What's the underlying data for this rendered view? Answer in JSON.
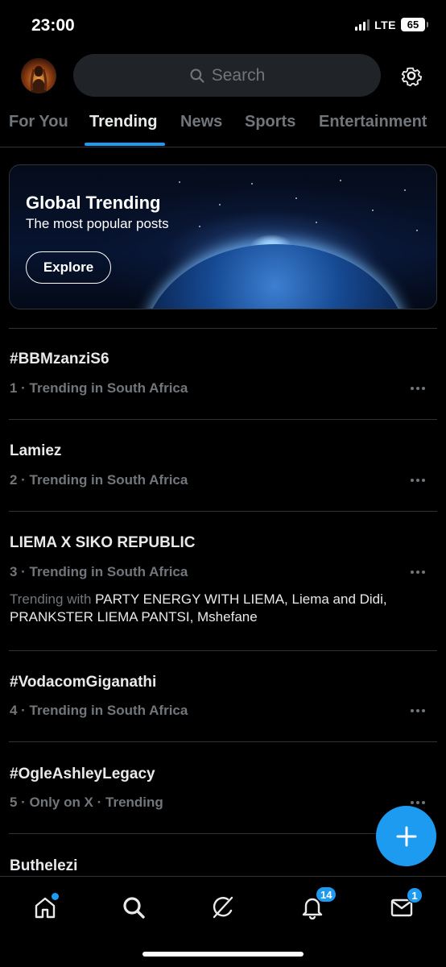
{
  "status_bar": {
    "time": "23:00",
    "network": "LTE",
    "battery": "65"
  },
  "header": {
    "search_placeholder": "Search"
  },
  "tabs": [
    {
      "label": "For You"
    },
    {
      "label": "Trending"
    },
    {
      "label": "News"
    },
    {
      "label": "Sports"
    },
    {
      "label": "Entertainment"
    }
  ],
  "active_tab": "Trending",
  "banner": {
    "title": "Global Trending",
    "subtitle": "The most popular posts",
    "button_label": "Explore"
  },
  "trends": [
    {
      "title": "#BBMzanziS6",
      "meta": "1 · Trending in South Africa"
    },
    {
      "title": "Lamiez",
      "meta": "2 · Trending in South Africa"
    },
    {
      "title": "LIEMA X SIKO REPUBLIC",
      "meta": "3 · Trending in South Africa",
      "trending_with_label": "Trending with",
      "trending_with": "PARTY ENERGY WITH LIEMA, Liema and Didi, PRANKSTER LIEMA PANTSI, Mshefane"
    },
    {
      "title": "#VodacomGiganathi",
      "meta": "4 · Trending in South Africa"
    },
    {
      "title": "#OgleAshleyLegacy",
      "meta": "5 · Only on X · Trending"
    },
    {
      "title": "Buthelezi",
      "meta": ""
    }
  ],
  "bottom_nav": {
    "notifications_badge": "14",
    "messages_badge": "1"
  },
  "colors": {
    "accent": "#1d9bf0",
    "background": "#000000",
    "muted": "#71767b",
    "text": "#e7e9ea"
  },
  "icons": [
    "home-icon",
    "search-icon",
    "grok-icon",
    "bell-icon",
    "mail-icon",
    "gear-icon",
    "plus-icon"
  ]
}
